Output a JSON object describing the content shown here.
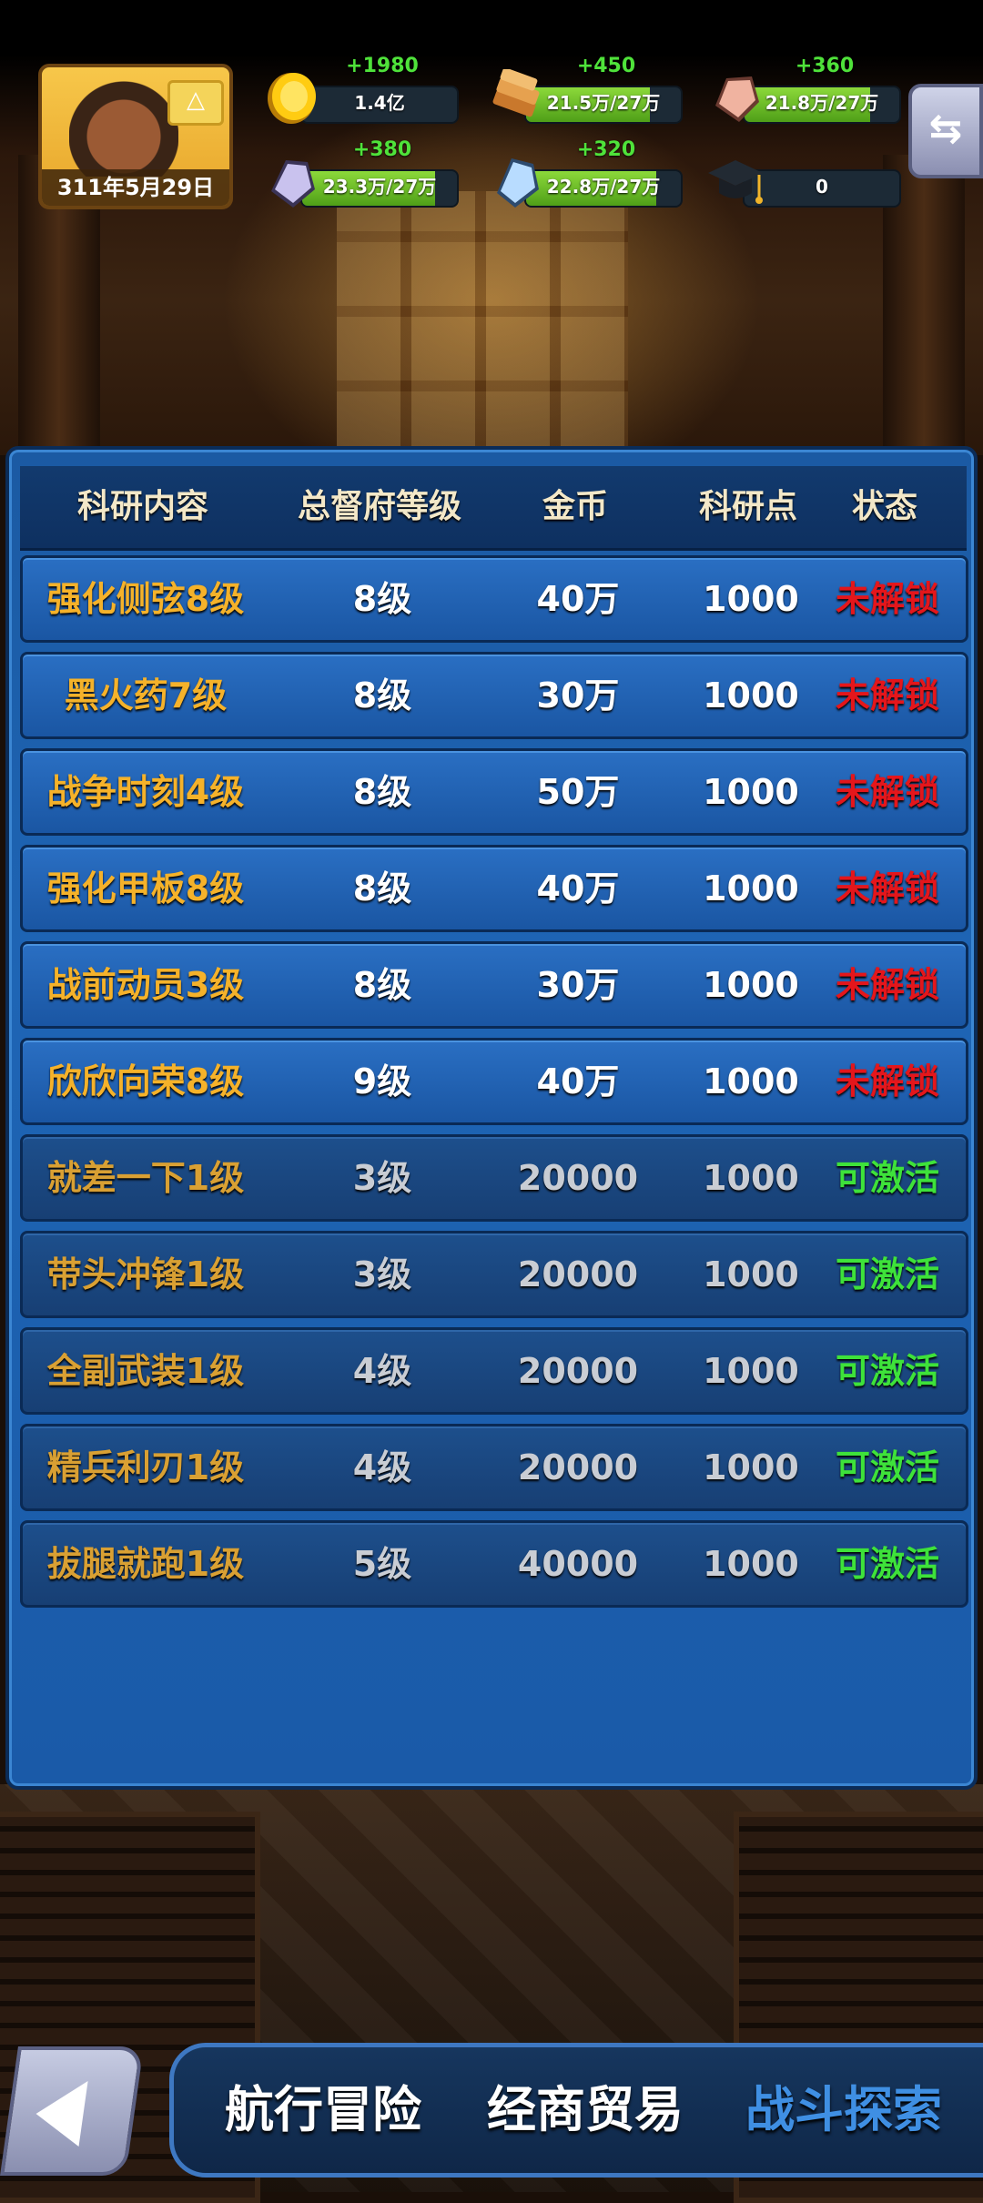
{
  "hud": {
    "date": "311年5月29日",
    "badge_icon": "triangle-badge-icon",
    "resources": [
      {
        "name": "gold",
        "icon": "gold-coin-icon",
        "plus": "+1980",
        "value": "1.4亿",
        "fill": 0
      },
      {
        "name": "wood",
        "icon": "wood-planks-icon",
        "plus": "+450",
        "value": "21.5万/27万",
        "fill": 0.8
      },
      {
        "name": "meat",
        "icon": "pink-ore-icon",
        "plus": "+360",
        "value": "21.8万/27万",
        "fill": 0.81
      },
      {
        "name": "stone",
        "icon": "purple-crystal-icon",
        "plus": "+380",
        "value": "23.3万/27万",
        "fill": 0.86
      },
      {
        "name": "crystal",
        "icon": "blue-crystal-icon",
        "plus": "+320",
        "value": "22.8万/27万",
        "fill": 0.84
      },
      {
        "name": "research",
        "icon": "graduation-cap-icon",
        "plus": "",
        "value": "0",
        "fill": 0
      }
    ],
    "swap_label": "⇆"
  },
  "table": {
    "headers": [
      "科研内容",
      "总督府等级",
      "金币",
      "科研点",
      "状态"
    ],
    "rows": [
      {
        "name": "强化侧弦8级",
        "level": "8级",
        "gold": "40万",
        "points": "1000",
        "status": "未解锁",
        "state": "locked"
      },
      {
        "name": "黑火药7级",
        "level": "8级",
        "gold": "30万",
        "points": "1000",
        "status": "未解锁",
        "state": "locked"
      },
      {
        "name": "战争时刻4级",
        "level": "8级",
        "gold": "50万",
        "points": "1000",
        "status": "未解锁",
        "state": "locked"
      },
      {
        "name": "强化甲板8级",
        "level": "8级",
        "gold": "40万",
        "points": "1000",
        "status": "未解锁",
        "state": "locked"
      },
      {
        "name": "战前动员3级",
        "level": "8级",
        "gold": "30万",
        "points": "1000",
        "status": "未解锁",
        "state": "locked"
      },
      {
        "name": "欣欣向荣8级",
        "level": "9级",
        "gold": "40万",
        "points": "1000",
        "status": "未解锁",
        "state": "locked"
      },
      {
        "name": "就差一下1级",
        "level": "3级",
        "gold": "20000",
        "points": "1000",
        "status": "可激活",
        "state": "active"
      },
      {
        "name": "带头冲锋1级",
        "level": "3级",
        "gold": "20000",
        "points": "1000",
        "status": "可激活",
        "state": "active"
      },
      {
        "name": "全副武装1级",
        "level": "4级",
        "gold": "20000",
        "points": "1000",
        "status": "可激活",
        "state": "active"
      },
      {
        "name": "精兵利刃1级",
        "level": "4级",
        "gold": "20000",
        "points": "1000",
        "status": "可激活",
        "state": "active"
      },
      {
        "name": "拔腿就跑1级",
        "level": "5级",
        "gold": "40000",
        "points": "1000",
        "status": "可激活",
        "state": "active"
      }
    ]
  },
  "nav": {
    "items": [
      "航行冒险",
      "经商贸易",
      "战斗探索"
    ],
    "active_index": 2
  },
  "colors": {
    "locked_status": "#e4161b",
    "active_status": "#3ee23a",
    "name_text": "#f5b22a",
    "panel_blue": "#1e65b5"
  }
}
